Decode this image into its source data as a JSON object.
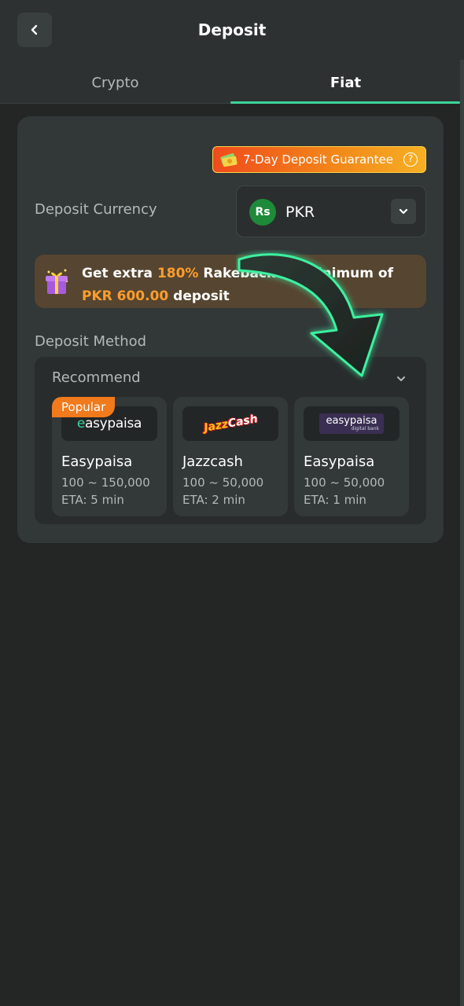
{
  "header": {
    "title": "Deposit"
  },
  "tabs": [
    {
      "label": "Crypto",
      "active": false
    },
    {
      "label": "Fiat",
      "active": true
    }
  ],
  "guarantee": {
    "label": "7-Day Deposit Guarantee",
    "help_icon": "?"
  },
  "currency": {
    "label": "Deposit Currency",
    "icon_text": "Rs",
    "value": "PKR"
  },
  "promo": {
    "prefix": "Get extra ",
    "percent": "180%",
    "middle": " Rakeback on ",
    "obscured": "minimum",
    "suffix": " of",
    "amount": "PKR 600.00",
    "tail": " deposit"
  },
  "deposit_method": {
    "label": "Deposit Method",
    "group_label": "Recommend",
    "badge": "Popular",
    "methods": [
      {
        "logo_text": "easypaisa",
        "logo_dot": "e",
        "logo_rest": "asypaisa",
        "name": "Easypaisa",
        "range": "100 ~ 150,000",
        "eta": "ETA: 5 min",
        "popular": true
      },
      {
        "logo_text": "JazzCash",
        "logo_a": "Jazz",
        "logo_b": "Cash",
        "name": "Jazzcash",
        "range": "100 ~ 50,000",
        "eta": "ETA: 2 min",
        "popular": false
      },
      {
        "logo_text": "easypaisa",
        "logo_sub": "digital bank",
        "name": "Easypaisa",
        "range": "100 ~ 50,000",
        "eta": "ETA: 1 min",
        "popular": false
      }
    ]
  },
  "colors": {
    "accent_green": "#3ed49a",
    "highlight_orange": "#ff9e2c",
    "background": "#242626",
    "card": "#323737"
  },
  "icons": {
    "back": "chevron-left-icon",
    "dropdown": "chevron-down-icon",
    "gift": "gift-icon",
    "pointer_arrow": "curved-arrow-icon"
  }
}
